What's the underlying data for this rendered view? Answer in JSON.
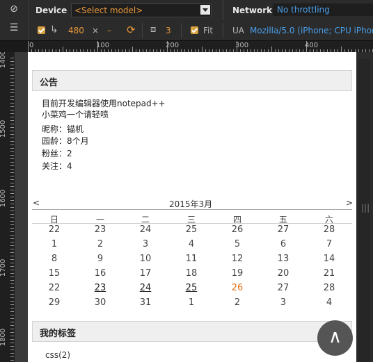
{
  "toolbar": {
    "device_label": "Device",
    "device_select": "<Select model>",
    "network_label": "Network",
    "network_select": "No throttling",
    "width": "480",
    "times": "×",
    "height": "–",
    "scale": "3",
    "fit_label": "Fit",
    "ua_label": "UA",
    "ua_value": "Mozilla/5.0 (iPhone; CPU iPhone"
  },
  "ruler_top": [
    "0",
    "100",
    "200",
    "300",
    "400"
  ],
  "ruler_left": [
    "1400",
    "1500",
    "1600",
    "1700",
    "1800"
  ],
  "announce": {
    "title": "公告",
    "lines": [
      "目前开发编辑器使用notepad++",
      "小菜鸡一个请轻喷",
      "昵称：锚机",
      "园龄：8个月",
      "粉丝：2",
      "关注：4"
    ]
  },
  "calendar": {
    "prev": "<",
    "title": "2015年3月",
    "next": ">",
    "headers": [
      "日",
      "一",
      "二",
      "三",
      "四",
      "五",
      "六"
    ],
    "weeks": [
      [
        "22",
        "23",
        "24",
        "25",
        "26",
        "27",
        "28"
      ],
      [
        "1",
        "2",
        "3",
        "4",
        "5",
        "6",
        "7"
      ],
      [
        "8",
        "9",
        "10",
        "11",
        "12",
        "13",
        "14"
      ],
      [
        "15",
        "16",
        "17",
        "18",
        "19",
        "20",
        "21"
      ],
      [
        "22",
        "23",
        "24",
        "25",
        "26",
        "27",
        "28"
      ],
      [
        "29",
        "30",
        "31",
        "1",
        "2",
        "3",
        "4"
      ]
    ],
    "linked": [
      "4-1",
      "4-2",
      "4-3"
    ],
    "today": "4-4"
  },
  "tags": {
    "title": "我的标签",
    "first": "css(2)"
  },
  "back_to_top": "∧",
  "colors": {
    "accent_orange": "#e7973a",
    "link_blue": "#4a9ee8",
    "today": "#e7731a"
  }
}
